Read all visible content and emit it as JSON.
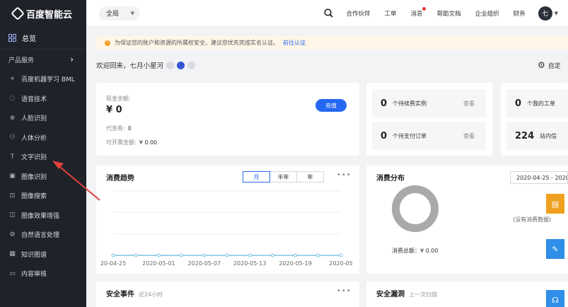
{
  "sidebar": {
    "logo_text": "百度智能云",
    "overview": "总览",
    "section": "产品服务",
    "items": [
      {
        "label": "百度机器学习 BML",
        "icon": "ml-icon"
      },
      {
        "label": "语音技术",
        "icon": "voice-icon"
      },
      {
        "label": "人脸识别",
        "icon": "face-icon"
      },
      {
        "label": "人体分析",
        "icon": "body-icon"
      },
      {
        "label": "文字识别",
        "icon": "text-recognition-icon"
      },
      {
        "label": "图像识别",
        "icon": "image-recognition-icon"
      },
      {
        "label": "图像搜索",
        "icon": "image-search-icon"
      },
      {
        "label": "图像效果增强",
        "icon": "image-enhance-icon"
      },
      {
        "label": "自然语言处理",
        "icon": "nlp-icon"
      },
      {
        "label": "知识图谱",
        "icon": "knowledge-graph-icon"
      },
      {
        "label": "内容审核",
        "icon": "content-audit-icon"
      }
    ]
  },
  "topbar": {
    "scope": "全局",
    "links": [
      "合作伙伴",
      "工单",
      "消息",
      "帮助文档",
      "企业组织",
      "财务"
    ],
    "avatar": "七"
  },
  "notice": {
    "text": "为保证您的账户和资源的所属权安全，建议您优先完成实名认证。",
    "link": "前往认证"
  },
  "welcome": "欢迎回来，七月小星河",
  "settings_label": "自定",
  "balance": {
    "label": "现金余额:",
    "value": "¥ 0",
    "recharge": "充值",
    "voucher_label": "代金券:",
    "voucher_value": "0",
    "invoice_label": "可开票金额:",
    "invoice_value": "¥ 0.00"
  },
  "pending": [
    {
      "num": "0",
      "label": "个待续费实例",
      "action": "查看"
    },
    {
      "num": "0",
      "label": "个待支付订单",
      "action": "查看"
    }
  ],
  "right_stats": [
    {
      "num": "0",
      "label": "个我的工单"
    },
    {
      "num": "224",
      "label": "站内信"
    }
  ],
  "trend": {
    "title": "消费趋势",
    "tabs": [
      "月",
      "半年",
      "年"
    ],
    "active_tab": "月"
  },
  "distribution": {
    "title": "消费分布",
    "date": "2020-04-25 - 2020",
    "total": "消费总额：¥ 0.00",
    "no_data": "(没有消费数据)"
  },
  "security": {
    "title": "安全事件",
    "subtitle": "近24小时"
  },
  "leak": {
    "title": "安全漏洞",
    "subtitle": "上一次扫描"
  },
  "colors": {
    "accent": "#2468f2",
    "sidebar": "#20222a",
    "warning": "#f59a23",
    "annotation": "#e0413b"
  },
  "chart_data": {
    "type": "line",
    "title": "消费趋势",
    "x": [
      "2020-04-25",
      "2020-04-28",
      "2020-05-01",
      "2020-05-04",
      "2020-05-07",
      "2020-05-10",
      "2020-05-13",
      "2020-05-16",
      "2020-05-19",
      "2020-05-22",
      "2020-05-25"
    ],
    "x_tick_labels": [
      "20-04-25",
      "2020-05-01",
      "2020-05-07",
      "2020-05-13",
      "2020-05-19",
      "2020-05"
    ],
    "series": [
      {
        "values": [
          0,
          0,
          0,
          0,
          0,
          0,
          0,
          0,
          0,
          0,
          0
        ]
      }
    ],
    "grid": true
  }
}
